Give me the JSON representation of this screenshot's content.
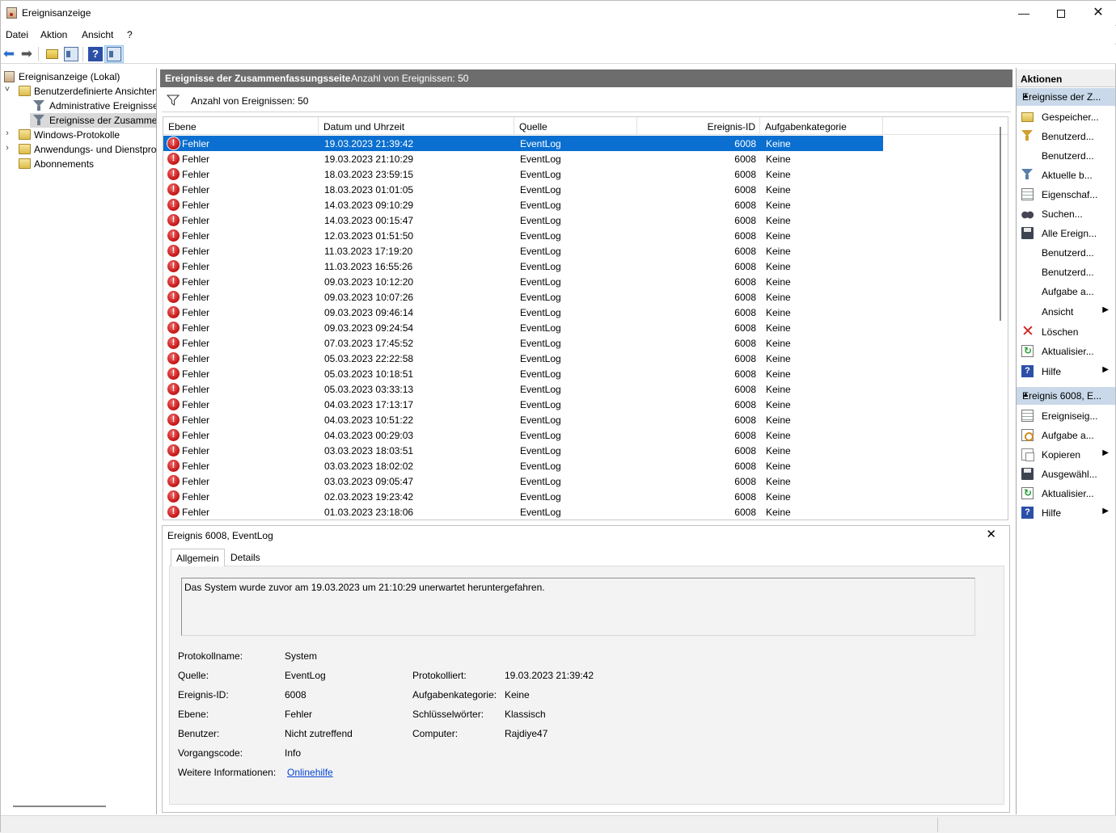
{
  "window": {
    "title": "Ereignisanzeige",
    "min": "—",
    "close": "✕"
  },
  "menu": [
    "Datei",
    "Aktion",
    "Ansicht",
    "?"
  ],
  "toolbar": {
    "help_label": "?"
  },
  "tree": [
    {
      "label": "Ereignisanzeige (Lokal)",
      "icon": "event-log-icon"
    },
    {
      "label": "Benutzerdefinierte Ansichten",
      "icon": "folder-icon",
      "chevron": "˅"
    },
    {
      "label": "Administrative Ereignisse",
      "icon": "filter-icon"
    },
    {
      "label": "Ereignisse der Zusammenfassungsseite",
      "icon": "filter-icon",
      "selected": true
    },
    {
      "label": "Windows-Protokolle",
      "icon": "folder-icon",
      "chevron": "›"
    },
    {
      "label": "Anwendungs- und Dienstprotokolle",
      "icon": "folder-icon",
      "chevron": "›"
    },
    {
      "label": "Abonnements",
      "icon": "folder-icon"
    }
  ],
  "center": {
    "title": "Ereignisse der Zusammenfassungsseite",
    "count_label": "Anzahl von Ereignissen: 50",
    "filter_text": "Anzahl von Ereignissen: 50"
  },
  "table": {
    "columns": [
      "Ebene",
      "Datum und Uhrzeit",
      "Quelle",
      "Ereignis-ID",
      "Aufgabenkategorie"
    ],
    "error_glyph": "!",
    "rows": [
      [
        "Fehler",
        "19.03.2023 21:39:42",
        "EventLog",
        "6008",
        "Keine"
      ],
      [
        "Fehler",
        "19.03.2023 21:10:29",
        "EventLog",
        "6008",
        "Keine"
      ],
      [
        "Fehler",
        "18.03.2023 23:59:15",
        "EventLog",
        "6008",
        "Keine"
      ],
      [
        "Fehler",
        "18.03.2023 01:01:05",
        "EventLog",
        "6008",
        "Keine"
      ],
      [
        "Fehler",
        "14.03.2023 09:10:29",
        "EventLog",
        "6008",
        "Keine"
      ],
      [
        "Fehler",
        "14.03.2023 00:15:47",
        "EventLog",
        "6008",
        "Keine"
      ],
      [
        "Fehler",
        "12.03.2023 01:51:50",
        "EventLog",
        "6008",
        "Keine"
      ],
      [
        "Fehler",
        "11.03.2023 17:19:20",
        "EventLog",
        "6008",
        "Keine"
      ],
      [
        "Fehler",
        "11.03.2023 16:55:26",
        "EventLog",
        "6008",
        "Keine"
      ],
      [
        "Fehler",
        "09.03.2023 10:12:20",
        "EventLog",
        "6008",
        "Keine"
      ],
      [
        "Fehler",
        "09.03.2023 10:07:26",
        "EventLog",
        "6008",
        "Keine"
      ],
      [
        "Fehler",
        "09.03.2023 09:46:14",
        "EventLog",
        "6008",
        "Keine"
      ],
      [
        "Fehler",
        "09.03.2023 09:24:54",
        "EventLog",
        "6008",
        "Keine"
      ],
      [
        "Fehler",
        "07.03.2023 17:45:52",
        "EventLog",
        "6008",
        "Keine"
      ],
      [
        "Fehler",
        "05.03.2023 22:22:58",
        "EventLog",
        "6008",
        "Keine"
      ],
      [
        "Fehler",
        "05.03.2023 10:18:51",
        "EventLog",
        "6008",
        "Keine"
      ],
      [
        "Fehler",
        "05.03.2023 03:33:13",
        "EventLog",
        "6008",
        "Keine"
      ],
      [
        "Fehler",
        "04.03.2023 17:13:17",
        "EventLog",
        "6008",
        "Keine"
      ],
      [
        "Fehler",
        "04.03.2023 10:51:22",
        "EventLog",
        "6008",
        "Keine"
      ],
      [
        "Fehler",
        "04.03.2023 00:29:03",
        "EventLog",
        "6008",
        "Keine"
      ],
      [
        "Fehler",
        "03.03.2023 18:03:51",
        "EventLog",
        "6008",
        "Keine"
      ],
      [
        "Fehler",
        "03.03.2023 18:02:02",
        "EventLog",
        "6008",
        "Keine"
      ],
      [
        "Fehler",
        "03.03.2023 09:05:47",
        "EventLog",
        "6008",
        "Keine"
      ],
      [
        "Fehler",
        "02.03.2023 19:23:42",
        "EventLog",
        "6008",
        "Keine"
      ],
      [
        "Fehler",
        "01.03.2023 23:18:06",
        "EventLog",
        "6008",
        "Keine"
      ]
    ],
    "selected_row": 0
  },
  "detail": {
    "header": "Ereignis 6008, EventLog",
    "close": "✕",
    "tabs": [
      "Allgemein",
      "Details"
    ],
    "message": "Das System wurde zuvor am 19.03.2023 um 21:10:29 unerwartet heruntergefahren.",
    "fields_left": [
      {
        "label": "Protokollname:",
        "value": "System"
      },
      {
        "label": "Quelle:",
        "value": "EventLog"
      },
      {
        "label": "Ereignis-ID:",
        "value": "6008"
      },
      {
        "label": "Ebene:",
        "value": "Fehler"
      },
      {
        "label": "Benutzer:",
        "value": "Nicht zutreffend"
      },
      {
        "label": "Vorgangscode:",
        "value": "Info"
      },
      {
        "label": "Weitere Informationen:",
        "value": "Onlinehilfe",
        "link": true
      }
    ],
    "fields_right": [
      {
        "label": "Protokolliert:",
        "value": "19.03.2023 21:39:42"
      },
      {
        "label": "Aufgabenkategorie:",
        "value": "Keine"
      },
      {
        "label": "Schlüsselwörter:",
        "value": "Klassisch"
      },
      {
        "label": "Computer:",
        "value": "Rajdiye47"
      }
    ]
  },
  "actions": {
    "title": "Aktionen",
    "group1": {
      "label": "Ereignisse der Z...",
      "items": [
        {
          "label": "Gespeicher...",
          "icon": "open-folder-icon"
        },
        {
          "label": "Benutzerd...",
          "icon": "create-filter-icon"
        },
        {
          "label": "Benutzerd...",
          "icon": ""
        },
        {
          "label": "Aktuelle b...",
          "icon": "filter-icon"
        },
        {
          "label": "Eigenschaf...",
          "icon": "properties-icon"
        },
        {
          "label": "Suchen...",
          "icon": "binoculars-icon"
        },
        {
          "label": "Alle Ereign...",
          "icon": "save-icon"
        },
        {
          "label": "Benutzerd...",
          "icon": ""
        },
        {
          "label": "Benutzerd...",
          "icon": ""
        },
        {
          "label": "Aufgabe a...",
          "icon": ""
        },
        {
          "label": "Ansicht",
          "icon": "",
          "submenu": true
        },
        {
          "label": "Löschen",
          "icon": "delete-icon"
        },
        {
          "label": "Aktualisier...",
          "icon": "refresh-icon"
        },
        {
          "label": "Hilfe",
          "icon": "help-icon",
          "submenu": true
        }
      ]
    },
    "group2": {
      "label": "Ereignis 6008, E...",
      "items": [
        {
          "label": "Ereigniseig...",
          "icon": "event-properties-icon"
        },
        {
          "label": "Aufgabe a...",
          "icon": "task-icon"
        },
        {
          "label": "Kopieren",
          "icon": "copy-icon",
          "submenu": true
        },
        {
          "label": "Ausgewähl...",
          "icon": "save-icon"
        },
        {
          "label": "Aktualisier...",
          "icon": "refresh-icon"
        },
        {
          "label": "Hilfe",
          "icon": "help-icon",
          "submenu": true
        }
      ]
    }
  }
}
